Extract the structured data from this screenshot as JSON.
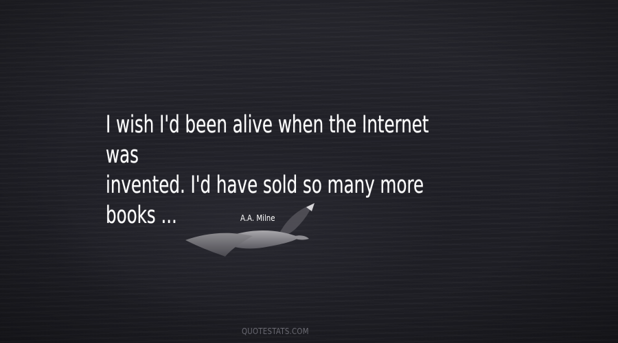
{
  "quote": {
    "text": "I wish I'd been alive when the Internet was\ninvented. I'd have sold so many more books ..."
  },
  "author": {
    "name": "A.A. Milne"
  },
  "watermark": {
    "text": "QUOTESTATS.COM"
  }
}
